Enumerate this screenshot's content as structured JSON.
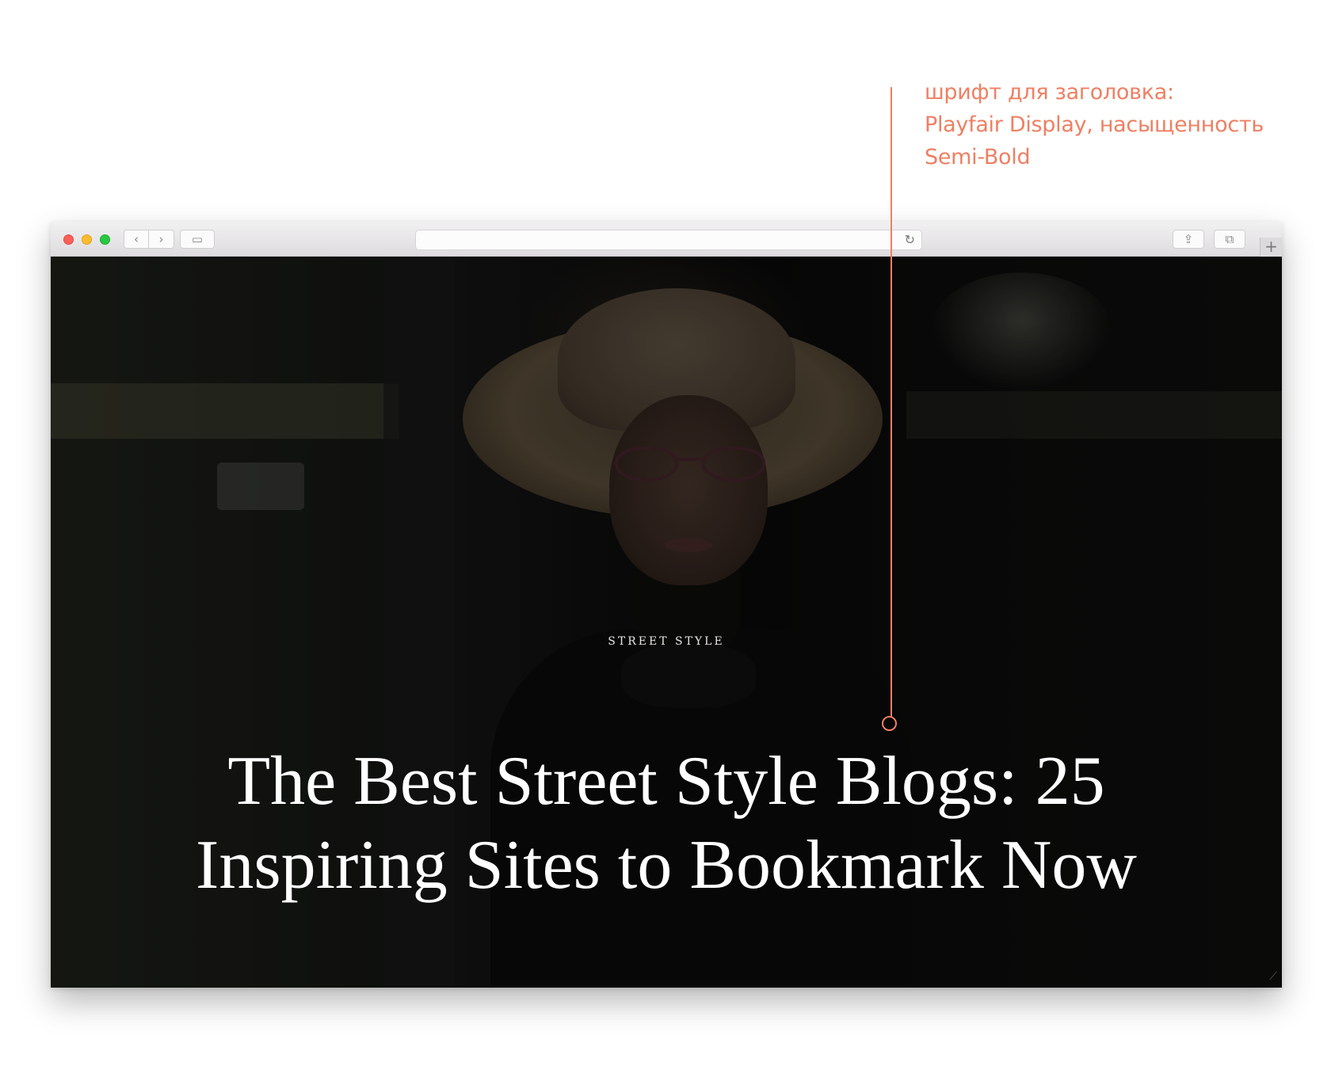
{
  "annotation": {
    "lines": [
      "шрифт для заголовка:",
      "Playfair Display, насыщенность",
      "Semi-Bold"
    ],
    "color": "#ef7f62"
  },
  "browser": {
    "nav_back_icon": "‹",
    "nav_forward_icon": "›",
    "sidebar_icon": "▭",
    "reload_icon": "↻",
    "share_icon": "⇪",
    "tabs_icon": "⧉",
    "new_tab_icon": "+"
  },
  "hero": {
    "category": "STREET STYLE",
    "headline_lines": [
      "The Best Street Style Blogs: 25",
      "Inspiring Sites to Bookmark Now"
    ]
  }
}
